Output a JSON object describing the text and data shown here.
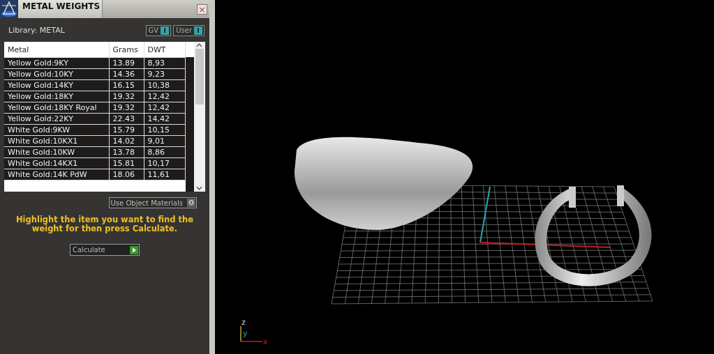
{
  "panel": {
    "title": "METAL WEIGHTS",
    "close": "×",
    "library": "Library: METAL",
    "toggles": [
      {
        "label": "GV",
        "indicator": "I",
        "on": true
      },
      {
        "label": "User",
        "indicator": "I",
        "on": true
      }
    ],
    "table": {
      "columns": [
        "Metal",
        "Grams",
        "DWT"
      ],
      "rows": [
        {
          "cells": [
            "Yellow Gold:9KY",
            "13.89",
            "8,93"
          ],
          "selected": false
        },
        {
          "cells": [
            "Yellow Gold:10KY",
            "14.36",
            "9,23"
          ],
          "selected": false
        },
        {
          "cells": [
            "Yellow Gold:14KY",
            "16.15",
            "10,38"
          ],
          "selected": false
        },
        {
          "cells": [
            "Yellow Gold:18KY",
            "19.32",
            "12,42"
          ],
          "selected": false
        },
        {
          "cells": [
            "Yellow Gold:18KY Royal",
            "19.32",
            "12,42"
          ],
          "selected": false
        },
        {
          "cells": [
            "Yellow Gold:22KY",
            "22.43",
            "14,42"
          ],
          "selected": false
        },
        {
          "cells": [
            "White Gold:9KW",
            "15.79",
            "10,15"
          ],
          "selected": false
        },
        {
          "cells": [
            "White Gold:10KX1",
            "14.02",
            "9,01"
          ],
          "selected": false
        },
        {
          "cells": [
            "White Gold:10KW",
            "13.78",
            "8,86"
          ],
          "selected": false
        },
        {
          "cells": [
            "White Gold:14KX1",
            "15.81",
            "10,17"
          ],
          "selected": false
        },
        {
          "cells": [
            "White Gold:14K PdW",
            "18.06",
            "11,61"
          ],
          "selected": false
        }
      ]
    },
    "object_materials": {
      "label": "Use Object Materials",
      "indicator": "O",
      "on": false
    },
    "message": "Highlight the item you want to find the weight for then press Calculate.",
    "calculate": "Calculate"
  },
  "viewport": {
    "axes": [
      "z",
      "y",
      "x"
    ]
  }
}
